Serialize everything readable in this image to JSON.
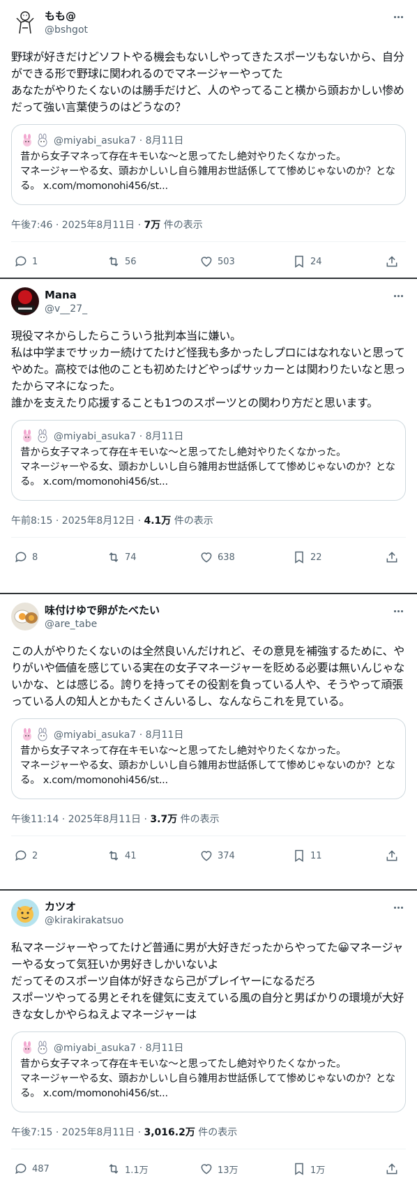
{
  "tweets": [
    {
      "display_name": "もも@",
      "handle": "@bshgot",
      "text": "野球が好きだけどソフトやる機会もないしやってきたスポーツもないから、自分ができる形で野球に関われるのでマネージャーやってた\nあなたがやりたくないのは勝手だけど、人のやってること横から頭おかしい惨めだって強い言葉使うのはどうなの？",
      "quote": {
        "meta": "@miyabi_asuka7 · 8月11日",
        "text": "昔から女子マネって存在キモいな〜と思ってたし絶対やりたくなかった。\nマネージャーやる女、頭おかしいし自ら雑用お世話係してて惨めじゃないのか？となる。 x.com/momonohi456/st..."
      },
      "time": "午後7:46 · 2025年8月11日 · ",
      "views": "7万",
      "views_suffix": " 件の表示",
      "replies": "1",
      "reposts": "56",
      "likes": "503",
      "bookmarks": "24"
    },
    {
      "display_name": "Mana",
      "handle": "@v__27_",
      "text": "現役マネからしたらこういう批判本当に嫌い。\n私は中学までサッカー続けてたけど怪我も多かったしプロにはなれないと思ってやめた。高校では他のことも初めたけどやっぱサッカーとは関わりたいなと思ったからマネになった。\n誰かを支えたり応援することも1つのスポーツとの関わり方だと思います。",
      "quote": {
        "meta": "@miyabi_asuka7 · 8月11日",
        "text": "昔から女子マネって存在キモいな〜と思ってたし絶対やりたくなかった。\nマネージャーやる女、頭おかしいし自ら雑用お世話係してて惨めじゃないのか？となる。 x.com/momonohi456/st..."
      },
      "time": "午前8:15 · 2025年8月12日 · ",
      "views": "4.1万",
      "views_suffix": " 件の表示",
      "replies": "8",
      "reposts": "74",
      "likes": "638",
      "bookmarks": "22"
    },
    {
      "display_name": "味付けゆで卵がたべたい",
      "handle": "@are_tabe",
      "text": "この人がやりたくないのは全然良いんだけれど、その意見を補強するために、やりがいや価値を感じている実在の女子マネージャーを貶める必要は無いんじゃないかな、とは感じる。誇りを持ってその役割を負っている人や、そうやって頑張っている人の知人とかもたくさんいるし、なんならこれを見ている。",
      "quote": {
        "meta": "@miyabi_asuka7 · 8月11日",
        "text": "昔から女子マネって存在キモいな〜と思ってたし絶対やりたくなかった。\nマネージャーやる女、頭おかしいし自ら雑用お世話係してて惨めじゃないのか？となる。 x.com/momonohi456/st..."
      },
      "time": "午後11:14 · 2025年8月11日 · ",
      "views": "3.7万",
      "views_suffix": " 件の表示",
      "replies": "2",
      "reposts": "41",
      "likes": "374",
      "bookmarks": "11"
    },
    {
      "display_name": "カツオ",
      "handle": "@kirakirakatsuo",
      "text": "私マネージャーやってたけど普通に男が大好きだったからやってた😀マネージャーやる女って気狂いか男好きしかいないよ\nだってそのスポーツ自体が好きなら己がプレイヤーになるだろ\nスポーツやってる男とそれを健気に支えている風の自分と男ばかりの環境が大好きな女しかやらねえよマネージャーは",
      "quote": {
        "meta": "@miyabi_asuka7 · 8月11日",
        "text": "昔から女子マネって存在キモいな〜と思ってたし絶対やりたくなかった。\nマネージャーやる女、頭おかしいし自ら雑用お世話係してて惨めじゃないのか？となる。 x.com/momonohi456/st..."
      },
      "time": "午後7:15 · 2025年8月11日 · ",
      "views": "3,016.2万",
      "views_suffix": " 件の表示",
      "replies": "487",
      "reposts": "1.1万",
      "likes": "13万",
      "bookmarks": "1万"
    }
  ],
  "colors": {
    "text": "#0f1419",
    "secondary": "#536471",
    "border": "#cfd9de",
    "separator": "#2f3336"
  }
}
